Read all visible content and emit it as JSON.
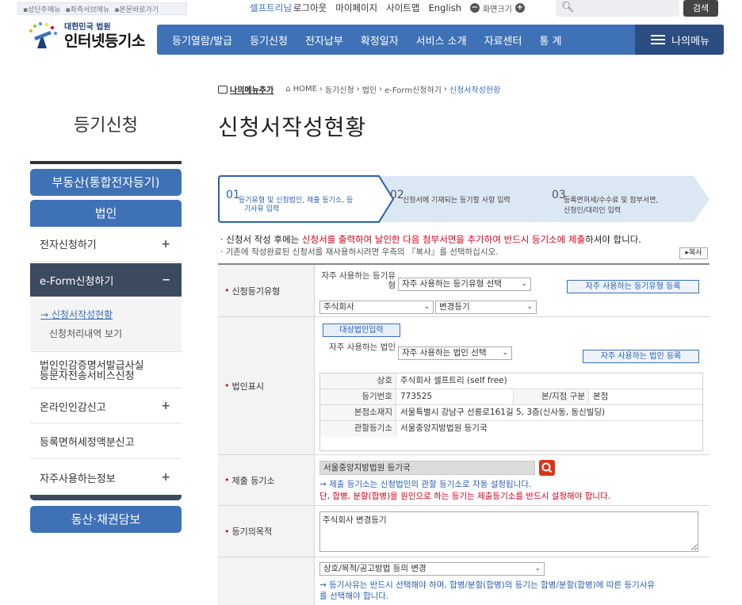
{
  "skip_links": [
    "상단주메뉴",
    "좌측서브메뉴",
    "본문바로가기"
  ],
  "util": {
    "user": "셀프트리님",
    "logout": "로그아웃",
    "mypage": "마이페이지",
    "sitemap": "사이트맵",
    "english": "English",
    "zoom_label": "화면크기",
    "search_button": "검색"
  },
  "logo": {
    "line1": "대한민국 법원",
    "line2": "인터넷등기소"
  },
  "nav": {
    "items": [
      "등기열람/발급",
      "등기신청",
      "전자납부",
      "확정일자",
      "서비스 소개",
      "자료센터",
      "통 계"
    ],
    "my_menu": "나의메뉴"
  },
  "breadcrumb": {
    "fav": "나의메뉴추가",
    "home": "HOME",
    "path": [
      "등기신청",
      "법인",
      "e-Form신청하기"
    ],
    "current": "신청서작성현황"
  },
  "sidebar": {
    "title": "등기신청",
    "realestate": "부동산(통합전자등기)",
    "corp": "법인",
    "items": [
      {
        "label": "전자신청하기",
        "expand": "+"
      },
      {
        "label": "e-Form신청하기",
        "expand": "−"
      },
      {
        "label": "법인인감증명서발급사실",
        "label2": "등문자전송서비스신청"
      },
      {
        "label": "온라인인감신고",
        "expand": "+"
      },
      {
        "label": "등록면허세정액분신고"
      },
      {
        "label": "자주사용하는정보",
        "expand": "+"
      }
    ],
    "sub_items": [
      "→ 신청서작성현황",
      "신청처리내역 보기"
    ],
    "movable": "동산·채권담보"
  },
  "page_title": "신청서작성현황",
  "steps": [
    {
      "num": "01",
      "text1": "등기유형 및 신청법인, 제출 등기소, 등",
      "text2": "기사유 입력"
    },
    {
      "num": "02",
      "text1": "신청서에 기재되는 등기할 사항 입력",
      "text2": ""
    },
    {
      "num": "03",
      "text1": "등록면허세/수수료 및 첨부서면,",
      "text2": "신청인/대리인 입력"
    }
  ],
  "notice": {
    "n1_a": "· 신청서 작성 후에는 ",
    "n1_b": "신청서를 출력하여 날인한 다음 첨부서면을 추가하여 반드시 등기소에 제출",
    "n1_c": "하셔야 합니다.",
    "n2": "· 기존에 작성완료된 신청서를 재사용하시려면 우측의 『복사』를 선택하십시오.",
    "copy": "▸복사"
  },
  "form": {
    "reg_type": {
      "label": "신청등기유형",
      "fav_label": "자주 사용하는 등기유형",
      "fav_select": "자주 사용하는 등기유형 선택",
      "fav_button": "자주 사용하는 등기유형 등록",
      "corp_type": "주식회사",
      "reg_kind": "변경등기"
    },
    "corp": {
      "label": "법인표시",
      "target_button": "대상법인입력",
      "fav_label": "자주 사용하는 법인",
      "fav_select": "자주 사용하는 법인 선택",
      "fav_button": "자주 사용하는 법인 등록",
      "rows": {
        "name_label": "상호",
        "name": "주식회사 셀프트리 (self free)",
        "regno_label": "등기번호",
        "regno": "773525",
        "branch_label": "본/지점 구분",
        "branch": "본점",
        "addr_label": "본점소재지",
        "addr": "서울특별시 강남구 선릉로161길 5, 3층(신사동, 동신빌딩)",
        "office_label": "관할등기소",
        "office": "서울중앙지방법원 등기국"
      }
    },
    "office": {
      "label": "제출 등기소",
      "value": "서울중앙지방법원  등기국",
      "note1": "→ 제출 등기소는 신청법인의 관할 등기소로 자동 설정됩니다.",
      "note2": "단, 합병, 분할(합병)을 원인으로 하는 등기는 제출등기소를 반드시 설정해야 합니다."
    },
    "purpose": {
      "label": "등기의목적",
      "value": "주식회사 변경등기"
    },
    "cause": {
      "select": "상호/목적/공고방법 등의 변경",
      "note1": "→ 등기사유는 반드시 선택해야 하며, 합병/분할(합병)의 등기는 합병/분할(합병)에 따른 등기사유",
      "note2": "를 선택해야 합니다."
    }
  }
}
